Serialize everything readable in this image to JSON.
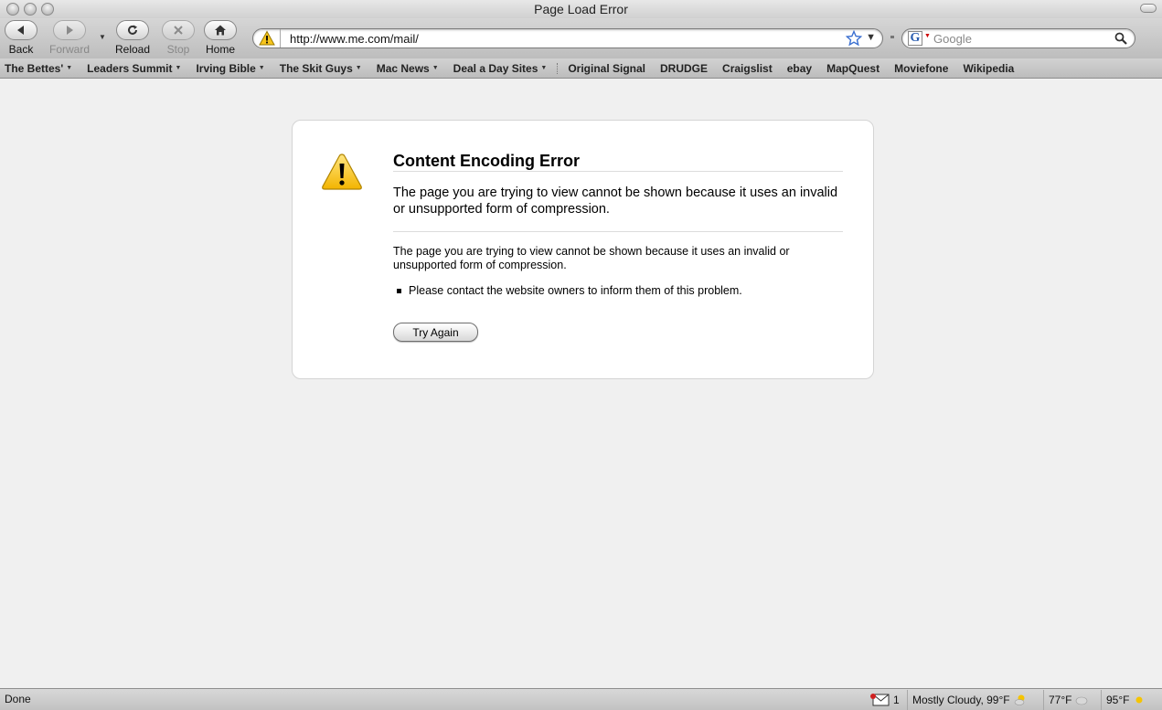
{
  "window": {
    "title": "Page Load Error"
  },
  "toolbar": {
    "back_label": "Back",
    "forward_label": "Forward",
    "reload_label": "Reload",
    "stop_label": "Stop",
    "home_label": "Home"
  },
  "urlbar": {
    "value": "http://www.me.com/mail/"
  },
  "search": {
    "placeholder": "Google"
  },
  "bookmarks": [
    {
      "label": "The Bettes'",
      "dropdown": true
    },
    {
      "label": "Leaders Summit",
      "dropdown": true
    },
    {
      "label": "Irving Bible",
      "dropdown": true
    },
    {
      "label": "The Skit Guys",
      "dropdown": true
    },
    {
      "label": "Mac News",
      "dropdown": true
    },
    {
      "label": "Deal a Day Sites",
      "dropdown": true
    },
    {
      "label": "Original Signal",
      "dropdown": false
    },
    {
      "label": "DRUDGE",
      "dropdown": false
    },
    {
      "label": "Craigslist",
      "dropdown": false
    },
    {
      "label": "ebay",
      "dropdown": false
    },
    {
      "label": "MapQuest",
      "dropdown": false
    },
    {
      "label": "Moviefone",
      "dropdown": false
    },
    {
      "label": "Wikipedia",
      "dropdown": false
    }
  ],
  "error": {
    "title": "Content Encoding Error",
    "short_desc": "The page you are trying to view cannot be shown because it uses an invalid or unsupported form of compression.",
    "long_desc": "The page you are trying to view cannot be shown because it uses an invalid or unsupported form of compression.",
    "bullets": [
      "Please contact the website owners to inform them of this problem."
    ],
    "try_again_label": "Try Again"
  },
  "status": {
    "text": "Done",
    "mail_count": "1",
    "weather": "Mostly Cloudy, 99°F",
    "temp1": "77°F",
    "temp2": "95°F"
  },
  "colors": {
    "warning_yellow": "#f7c51c",
    "card_bg": "#ffffff",
    "page_bg": "#f0f0f0"
  }
}
